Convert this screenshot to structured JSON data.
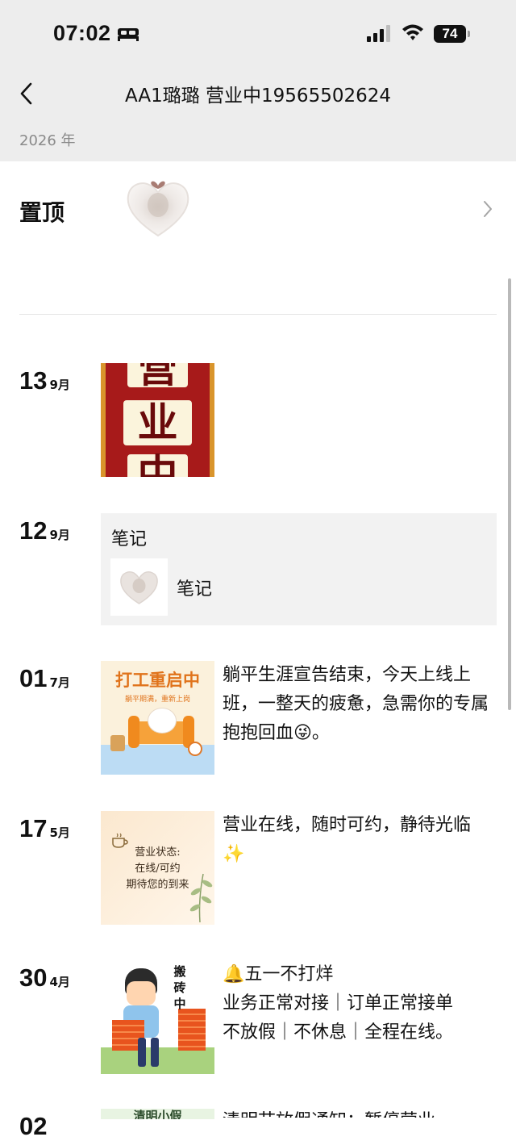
{
  "status_bar": {
    "time": "07:02",
    "battery": "74"
  },
  "nav": {
    "title": "AA1璐璐  营业中19565502624"
  },
  "year_header": "2026 年",
  "pinned": {
    "label": "置顶"
  },
  "posts": [
    {
      "day": "13",
      "month": "9月",
      "thumb_text": [
        "营",
        "业",
        "中"
      ]
    },
    {
      "day": "12",
      "month": "9月",
      "note_title": "笔记",
      "note_sub": "笔记"
    },
    {
      "day": "01",
      "month": "7月",
      "thumb_title": "打工重启中",
      "thumb_sub": "躺平期满，重新上岗",
      "text": "躺平生涯宣告结束，今天上线上班，一整天的疲惫，急需你的专属抱抱回血😜。"
    },
    {
      "day": "17",
      "month": "5月",
      "thumb_lines": [
        "营业状态:",
        "在线/可约",
        "期待您的到来"
      ],
      "text": "营业在线，随时可约，静待光临✨"
    },
    {
      "day": "30",
      "month": "4月",
      "thumb_side": [
        "搬",
        "砖",
        "中"
      ],
      "text_lines": [
        "🔔五一不打烊",
        "业务正常对接｜订单正常接单",
        "不放假｜不休息｜全程在线。"
      ]
    },
    {
      "day": "02",
      "thumb_text": "清明小假",
      "text": "清明节放假通知：暂停营业"
    }
  ]
}
